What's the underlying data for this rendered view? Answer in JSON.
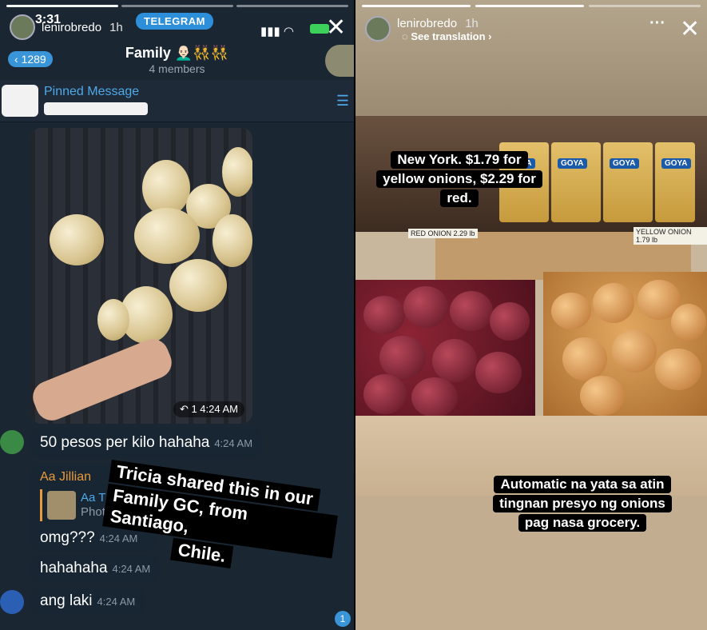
{
  "left_story": {
    "author": "lenirobredo",
    "time": "1h",
    "close_icon": "close-icon",
    "screenshot": {
      "status_time": "3:31",
      "telegram_badge": "TELEGRAM",
      "back_count": "1289",
      "chat_title": "Family 👨🏻‍🦲👯👯",
      "chat_members": "4 members",
      "pinned_label": "Pinned Message",
      "photo_forward": "↶ 1",
      "photo_time": "4:24 AM",
      "messages": [
        {
          "text": "50 pesos per kilo hahaha",
          "time": "4:24 AM"
        },
        {
          "text": "hahahaha",
          "time": "4:24 AM"
        },
        {
          "text": "ang laki",
          "time": "4:24 AM"
        }
      ],
      "reply": {
        "sender": "Aa Jillian",
        "quote_name": "Aa T",
        "quote_type": "Photo",
        "text": "omg???",
        "time": "4:24 AM"
      },
      "unread": "1"
    },
    "caption_lines": [
      "Tricia shared this in our",
      "Family GC, from Santiago,",
      "Chile."
    ]
  },
  "right_story": {
    "author": "lenirobredo",
    "time": "1h",
    "see_translation": "See translation ›",
    "more_icon": "more-icon",
    "close_icon": "close-icon",
    "brand": "GOYA",
    "top_caption_lines": [
      "New York. $1.79 for",
      "yellow onions, $2.29 for",
      "red."
    ],
    "price_tags": [
      "RED ONION 2.29 lb",
      "YELLOW ONION 1.79 lb"
    ],
    "bottom_caption_lines": [
      "Automatic na yata sa atin",
      "tingnan presyo ng onions",
      "pag nasa grocery."
    ]
  }
}
